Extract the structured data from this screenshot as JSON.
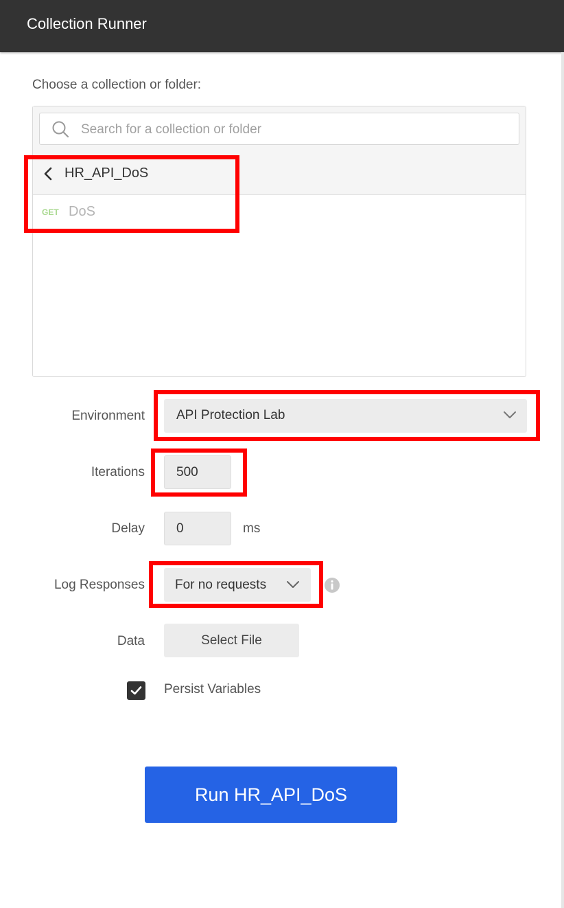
{
  "window": {
    "title": "Collection Runner"
  },
  "collection_picker": {
    "label": "Choose a collection or folder:",
    "search": {
      "placeholder": "Search for a collection or folder",
      "value": ""
    },
    "current_folder": "HR_API_DoS",
    "requests": [
      {
        "method": "GET",
        "name": "DoS"
      }
    ]
  },
  "form": {
    "environment": {
      "label": "Environment",
      "value": "API Protection Lab"
    },
    "iterations": {
      "label": "Iterations",
      "value": "500"
    },
    "delay": {
      "label": "Delay",
      "value": "0",
      "unit": "ms"
    },
    "log_responses": {
      "label": "Log Responses",
      "value": "For no requests"
    },
    "data": {
      "label": "Data",
      "button_label": "Select File"
    },
    "persist_variables": {
      "label": "Persist Variables",
      "checked": true
    }
  },
  "run_button": {
    "label": "Run HR_API_DoS"
  },
  "colors": {
    "titlebar": "#333333",
    "run_button": "#2563e5",
    "highlight": "#ff0000",
    "get_method": "#a8d88f"
  },
  "icons": [
    "search-icon",
    "chevron-left-icon",
    "chevron-down-icon",
    "info-icon",
    "checkmark-icon"
  ]
}
